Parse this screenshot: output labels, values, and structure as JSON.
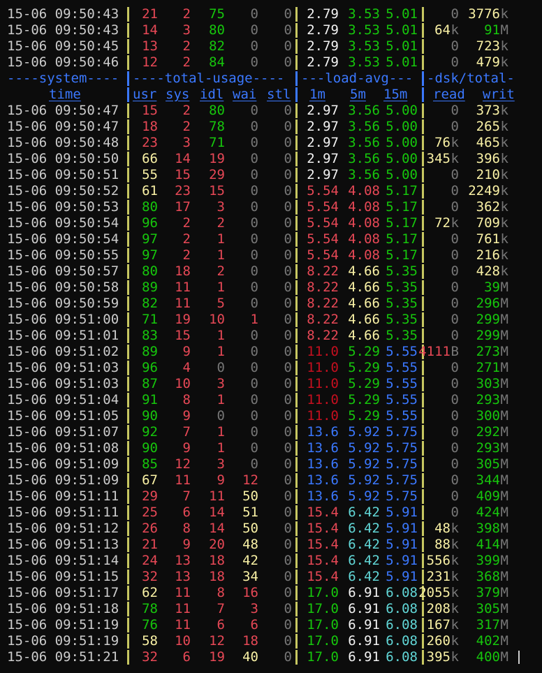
{
  "colors": {
    "background": "#0c0c0c",
    "text": "#cccccc",
    "red": "#e74856",
    "green": "#16c60c",
    "yellow": "#f9f1a5",
    "blue": "#3b78ff",
    "cyan": "#61d6d6",
    "white": "#f2f2f2",
    "dim": "#767676",
    "darkred": "#c50f1f"
  },
  "group_header": {
    "system": "----system----",
    "total_usage": "----total-usage----",
    "load_avg": "---load-avg---",
    "dsk_total": "-dsk/total-"
  },
  "column_header": {
    "time": "time",
    "usr": "usr",
    "sys": "sys",
    "idl": "idl",
    "wai": "wai",
    "stl": "stl",
    "l1": "1m",
    "l5": "5m",
    "l15": "15m",
    "read": "read",
    "writ": "writ"
  },
  "rows_before_header": [
    {
      "time": "15-06 09:50:43",
      "usr": "21",
      "sys": "2",
      "idl": "75",
      "wai": "0",
      "stl": "0",
      "l1": "2.79",
      "l5": "3.53",
      "l15": "5.01",
      "read": "0",
      "read_unit": "",
      "writ": "3776",
      "writ_unit": "k"
    },
    {
      "time": "15-06 09:50:43",
      "usr": "14",
      "sys": "3",
      "idl": "80",
      "wai": "0",
      "stl": "0",
      "l1": "2.79",
      "l5": "3.53",
      "l15": "5.01",
      "read": "64",
      "read_unit": "k",
      "writ": "91",
      "writ_unit": "M"
    },
    {
      "time": "15-06 09:50:45",
      "usr": "13",
      "sys": "2",
      "idl": "82",
      "wai": "0",
      "stl": "0",
      "l1": "2.79",
      "l5": "3.53",
      "l15": "5.01",
      "read": "0",
      "read_unit": "",
      "writ": "723",
      "writ_unit": "k"
    },
    {
      "time": "15-06 09:50:46",
      "usr": "12",
      "sys": "2",
      "idl": "84",
      "wai": "0",
      "stl": "0",
      "l1": "2.79",
      "l5": "3.53",
      "l15": "5.01",
      "read": "0",
      "read_unit": "",
      "writ": "479",
      "writ_unit": "k"
    }
  ],
  "rows_after_header": [
    {
      "time": "15-06 09:50:47",
      "usr": "15",
      "sys": "2",
      "idl": "80",
      "wai": "0",
      "stl": "0",
      "l1": "2.97",
      "l5": "3.56",
      "l15": "5.00",
      "read": "0",
      "read_unit": "",
      "writ": "373",
      "writ_unit": "k"
    },
    {
      "time": "15-06 09:50:47",
      "usr": "18",
      "sys": "2",
      "idl": "78",
      "wai": "0",
      "stl": "0",
      "l1": "2.97",
      "l5": "3.56",
      "l15": "5.00",
      "read": "0",
      "read_unit": "",
      "writ": "265",
      "writ_unit": "k"
    },
    {
      "time": "15-06 09:50:48",
      "usr": "23",
      "sys": "3",
      "idl": "71",
      "wai": "0",
      "stl": "0",
      "l1": "2.97",
      "l5": "3.56",
      "l15": "5.00",
      "read": "76",
      "read_unit": "k",
      "writ": "465",
      "writ_unit": "k"
    },
    {
      "time": "15-06 09:50:50",
      "usr": "66",
      "sys": "14",
      "idl": "19",
      "wai": "0",
      "stl": "0",
      "l1": "2.97",
      "l5": "3.56",
      "l15": "5.00",
      "read": "345",
      "read_unit": "k",
      "writ": "396",
      "writ_unit": "k"
    },
    {
      "time": "15-06 09:50:51",
      "usr": "55",
      "sys": "15",
      "idl": "29",
      "wai": "0",
      "stl": "0",
      "l1": "2.97",
      "l5": "3.56",
      "l15": "5.00",
      "read": "0",
      "read_unit": "",
      "writ": "210",
      "writ_unit": "k"
    },
    {
      "time": "15-06 09:50:52",
      "usr": "61",
      "sys": "23",
      "idl": "15",
      "wai": "0",
      "stl": "0",
      "l1": "5.54",
      "l5": "4.08",
      "l15": "5.17",
      "read": "0",
      "read_unit": "",
      "writ": "2249",
      "writ_unit": "k"
    },
    {
      "time": "15-06 09:50:53",
      "usr": "80",
      "sys": "17",
      "idl": "3",
      "wai": "0",
      "stl": "0",
      "l1": "5.54",
      "l5": "4.08",
      "l15": "5.17",
      "read": "0",
      "read_unit": "",
      "writ": "362",
      "writ_unit": "k"
    },
    {
      "time": "15-06 09:50:54",
      "usr": "96",
      "sys": "2",
      "idl": "2",
      "wai": "0",
      "stl": "0",
      "l1": "5.54",
      "l5": "4.08",
      "l15": "5.17",
      "read": "72",
      "read_unit": "k",
      "writ": "709",
      "writ_unit": "k"
    },
    {
      "time": "15-06 09:50:54",
      "usr": "97",
      "sys": "2",
      "idl": "1",
      "wai": "0",
      "stl": "0",
      "l1": "5.54",
      "l5": "4.08",
      "l15": "5.17",
      "read": "0",
      "read_unit": "",
      "writ": "761",
      "writ_unit": "k"
    },
    {
      "time": "15-06 09:50:55",
      "usr": "97",
      "sys": "2",
      "idl": "1",
      "wai": "0",
      "stl": "0",
      "l1": "5.54",
      "l5": "4.08",
      "l15": "5.17",
      "read": "0",
      "read_unit": "",
      "writ": "216",
      "writ_unit": "k"
    },
    {
      "time": "15-06 09:50:57",
      "usr": "80",
      "sys": "18",
      "idl": "2",
      "wai": "0",
      "stl": "0",
      "l1": "8.22",
      "l5": "4.66",
      "l15": "5.35",
      "read": "0",
      "read_unit": "",
      "writ": "428",
      "writ_unit": "k"
    },
    {
      "time": "15-06 09:50:58",
      "usr": "89",
      "sys": "11",
      "idl": "1",
      "wai": "0",
      "stl": "0",
      "l1": "8.22",
      "l5": "4.66",
      "l15": "5.35",
      "read": "0",
      "read_unit": "",
      "writ": "39",
      "writ_unit": "M"
    },
    {
      "time": "15-06 09:50:59",
      "usr": "82",
      "sys": "11",
      "idl": "5",
      "wai": "0",
      "stl": "0",
      "l1": "8.22",
      "l5": "4.66",
      "l15": "5.35",
      "read": "0",
      "read_unit": "",
      "writ": "296",
      "writ_unit": "M"
    },
    {
      "time": "15-06 09:51:00",
      "usr": "71",
      "sys": "19",
      "idl": "10",
      "wai": "1",
      "stl": "0",
      "l1": "8.22",
      "l5": "4.66",
      "l15": "5.35",
      "read": "0",
      "read_unit": "",
      "writ": "299",
      "writ_unit": "M"
    },
    {
      "time": "15-06 09:51:01",
      "usr": "83",
      "sys": "15",
      "idl": "1",
      "wai": "0",
      "stl": "0",
      "l1": "8.22",
      "l5": "4.66",
      "l15": "5.35",
      "read": "0",
      "read_unit": "",
      "writ": "299",
      "writ_unit": "M"
    },
    {
      "time": "15-06 09:51:02",
      "usr": "89",
      "sys": "9",
      "idl": "1",
      "wai": "0",
      "stl": "0",
      "l1": "11.0",
      "l5": "5.29",
      "l15": "5.55",
      "read": "4111",
      "read_unit": "B",
      "writ": "273",
      "writ_unit": "M"
    },
    {
      "time": "15-06 09:51:03",
      "usr": "96",
      "sys": "4",
      "idl": "0",
      "wai": "0",
      "stl": "0",
      "l1": "11.0",
      "l5": "5.29",
      "l15": "5.55",
      "read": "0",
      "read_unit": "",
      "writ": "271",
      "writ_unit": "M"
    },
    {
      "time": "15-06 09:51:03",
      "usr": "87",
      "sys": "10",
      "idl": "3",
      "wai": "0",
      "stl": "0",
      "l1": "11.0",
      "l5": "5.29",
      "l15": "5.55",
      "read": "0",
      "read_unit": "",
      "writ": "303",
      "writ_unit": "M"
    },
    {
      "time": "15-06 09:51:04",
      "usr": "91",
      "sys": "8",
      "idl": "1",
      "wai": "0",
      "stl": "0",
      "l1": "11.0",
      "l5": "5.29",
      "l15": "5.55",
      "read": "0",
      "read_unit": "",
      "writ": "293",
      "writ_unit": "M"
    },
    {
      "time": "15-06 09:51:05",
      "usr": "90",
      "sys": "9",
      "idl": "0",
      "wai": "0",
      "stl": "0",
      "l1": "11.0",
      "l5": "5.29",
      "l15": "5.55",
      "read": "0",
      "read_unit": "",
      "writ": "300",
      "writ_unit": "M"
    },
    {
      "time": "15-06 09:51:07",
      "usr": "92",
      "sys": "7",
      "idl": "1",
      "wai": "0",
      "stl": "0",
      "l1": "13.6",
      "l5": "5.92",
      "l15": "5.75",
      "read": "0",
      "read_unit": "",
      "writ": "292",
      "writ_unit": "M"
    },
    {
      "time": "15-06 09:51:08",
      "usr": "90",
      "sys": "9",
      "idl": "1",
      "wai": "0",
      "stl": "0",
      "l1": "13.6",
      "l5": "5.92",
      "l15": "5.75",
      "read": "0",
      "read_unit": "",
      "writ": "293",
      "writ_unit": "M"
    },
    {
      "time": "15-06 09:51:09",
      "usr": "85",
      "sys": "12",
      "idl": "3",
      "wai": "0",
      "stl": "0",
      "l1": "13.6",
      "l5": "5.92",
      "l15": "5.75",
      "read": "0",
      "read_unit": "",
      "writ": "305",
      "writ_unit": "M"
    },
    {
      "time": "15-06 09:51:09",
      "usr": "67",
      "sys": "11",
      "idl": "9",
      "wai": "12",
      "stl": "0",
      "l1": "13.6",
      "l5": "5.92",
      "l15": "5.75",
      "read": "0",
      "read_unit": "",
      "writ": "344",
      "writ_unit": "M"
    },
    {
      "time": "15-06 09:51:11",
      "usr": "29",
      "sys": "7",
      "idl": "11",
      "wai": "50",
      "stl": "0",
      "l1": "13.6",
      "l5": "5.92",
      "l15": "5.75",
      "read": "0",
      "read_unit": "",
      "writ": "409",
      "writ_unit": "M"
    },
    {
      "time": "15-06 09:51:11",
      "usr": "25",
      "sys": "6",
      "idl": "14",
      "wai": "51",
      "stl": "0",
      "l1": "15.4",
      "l5": "6.42",
      "l15": "5.91",
      "read": "0",
      "read_unit": "",
      "writ": "424",
      "writ_unit": "M"
    },
    {
      "time": "15-06 09:51:12",
      "usr": "26",
      "sys": "8",
      "idl": "14",
      "wai": "50",
      "stl": "0",
      "l1": "15.4",
      "l5": "6.42",
      "l15": "5.91",
      "read": "48",
      "read_unit": "k",
      "writ": "398",
      "writ_unit": "M"
    },
    {
      "time": "15-06 09:51:13",
      "usr": "21",
      "sys": "9",
      "idl": "20",
      "wai": "48",
      "stl": "0",
      "l1": "15.4",
      "l5": "6.42",
      "l15": "5.91",
      "read": "88",
      "read_unit": "k",
      "writ": "414",
      "writ_unit": "M"
    },
    {
      "time": "15-06 09:51:14",
      "usr": "24",
      "sys": "13",
      "idl": "18",
      "wai": "42",
      "stl": "0",
      "l1": "15.4",
      "l5": "6.42",
      "l15": "5.91",
      "read": "556",
      "read_unit": "k",
      "writ": "399",
      "writ_unit": "M"
    },
    {
      "time": "15-06 09:51:15",
      "usr": "32",
      "sys": "13",
      "idl": "18",
      "wai": "34",
      "stl": "0",
      "l1": "15.4",
      "l5": "6.42",
      "l15": "5.91",
      "read": "231",
      "read_unit": "k",
      "writ": "368",
      "writ_unit": "M"
    },
    {
      "time": "15-06 09:51:17",
      "usr": "62",
      "sys": "11",
      "idl": "8",
      "wai": "16",
      "stl": "0",
      "l1": "17.0",
      "l5": "6.91",
      "l15": "6.08",
      "read": "2055",
      "read_unit": "k",
      "writ": "379",
      "writ_unit": "M"
    },
    {
      "time": "15-06 09:51:18",
      "usr": "78",
      "sys": "11",
      "idl": "7",
      "wai": "3",
      "stl": "0",
      "l1": "17.0",
      "l5": "6.91",
      "l15": "6.08",
      "read": "208",
      "read_unit": "k",
      "writ": "305",
      "writ_unit": "M"
    },
    {
      "time": "15-06 09:51:19",
      "usr": "76",
      "sys": "11",
      "idl": "6",
      "wai": "6",
      "stl": "0",
      "l1": "17.0",
      "l5": "6.91",
      "l15": "6.08",
      "read": "167",
      "read_unit": "k",
      "writ": "317",
      "writ_unit": "M"
    },
    {
      "time": "15-06 09:51:19",
      "usr": "58",
      "sys": "10",
      "idl": "12",
      "wai": "18",
      "stl": "0",
      "l1": "17.0",
      "l5": "6.91",
      "l15": "6.08",
      "read": "260",
      "read_unit": "k",
      "writ": "402",
      "writ_unit": "M"
    },
    {
      "time": "15-06 09:51:21",
      "usr": "32",
      "sys": "6",
      "idl": "19",
      "wai": "40",
      "stl": "0",
      "l1": "17.0",
      "l5": "6.91",
      "l15": "6.08",
      "read": "395",
      "read_unit": "k",
      "writ": "400",
      "writ_unit": "M"
    }
  ]
}
